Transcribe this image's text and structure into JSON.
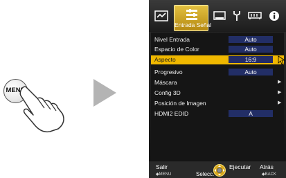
{
  "left": {
    "menu_button_label": "MENU"
  },
  "tabs": [
    {
      "icon": "picture-adjust-icon",
      "label": ""
    },
    {
      "icon": "input-signal-icon",
      "label": "Entrada Señal",
      "active": true
    },
    {
      "icon": "installation-icon",
      "label": ""
    },
    {
      "icon": "tool-icon",
      "label": ""
    },
    {
      "icon": "memory-icon",
      "label": ""
    },
    {
      "icon": "info-icon",
      "label": ""
    }
  ],
  "menu": {
    "rows": [
      {
        "label": "Nivel Entrada",
        "value": "Auto"
      },
      {
        "label": "Espacio de Color",
        "value": "Auto"
      },
      {
        "label": "Aspecto",
        "value": "16:9",
        "selected": true
      },
      {
        "label": "Progresivo",
        "value": "Auto"
      },
      {
        "label": "Máscara",
        "value": ""
      },
      {
        "label": "Config 3D",
        "value": ""
      },
      {
        "label": "Posición de Imagen",
        "value": ""
      },
      {
        "label": "HDMI2 EDID",
        "value": "A"
      }
    ]
  },
  "bottom": {
    "exit_label": "Salir",
    "exit_key": "◆MENU",
    "select_label": "Selecc.",
    "execute_label": "Ejecutar",
    "back_label": "Atrás",
    "back_key": "◆BACK"
  },
  "colors": {
    "highlight": "#f0b800",
    "value_bg": "#222e66",
    "tab_active": "#d4aa2a"
  }
}
